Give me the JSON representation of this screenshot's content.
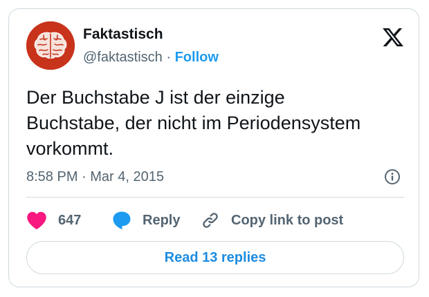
{
  "author": {
    "name": "Faktastisch",
    "handle": "@faktastisch",
    "separator": " · ",
    "follow_label": "Follow",
    "avatar_icon": "brain-icon",
    "avatar_color": "#c8331c"
  },
  "tweet": {
    "lines": [
      "Der Buchstabe J ist der einzige",
      "Buchstabe, der nicht im Periodensystem",
      "vorkommt."
    ],
    "time": "8:58 PM",
    "date_separator": " · ",
    "date": "Mar 4, 2015"
  },
  "actions": {
    "like_count": "647",
    "reply_label": "Reply",
    "copy_label": "Copy link to post",
    "read_replies_label": "Read 13 replies"
  },
  "colors": {
    "accent": "#1d9bf0",
    "like": "#f91880",
    "text": "#0f1419",
    "muted": "#536471",
    "border": "#cfd9de"
  },
  "icons": {
    "brand": "x-logo-icon",
    "info": "info-icon",
    "like": "heart-icon",
    "reply": "speech-bubble-icon",
    "copy": "link-icon"
  }
}
